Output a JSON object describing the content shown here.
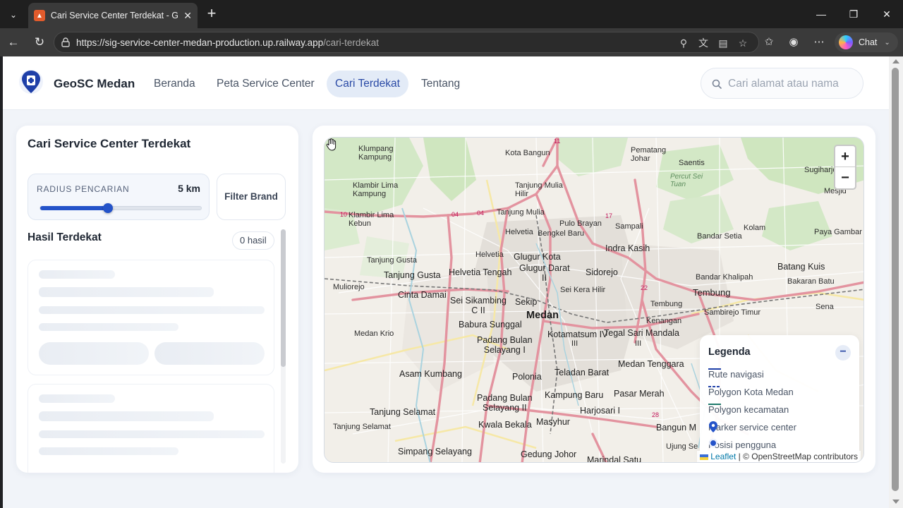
{
  "browser": {
    "tab_title": "Cari Service Center Terdekat - GeoSC Medan",
    "url_host": "https://sig-service-center-medan-production.up.railway.app",
    "url_path": "/cari-terdekat",
    "copilot_label": "Chat"
  },
  "navbar": {
    "brand": "GeoSC Medan",
    "links": [
      "Beranda",
      "Peta Service Center",
      "Cari Terdekat",
      "Tentang"
    ],
    "active_link": "Cari Terdekat",
    "search_placeholder": "Cari alamat atau nama"
  },
  "panel": {
    "title": "Cari Service Center Terdekat",
    "radius_label": "RADIUS PENCARIAN",
    "radius_value": "5 km",
    "radius_fraction": 0.42,
    "filter_button": "Filter Brand",
    "results_title": "Hasil Terdekat",
    "results_count": "0 hasil"
  },
  "map": {
    "zoom_in": "+",
    "zoom_out": "−",
    "legend_title": "Legenda",
    "legend_toggle": "−",
    "legend_items": [
      {
        "label": "Rute navigasi",
        "color": "#1e3fa8"
      },
      {
        "label": "Polygon Kota Medan",
        "color": "#1e3fa8"
      },
      {
        "label": "Polygon kecamatan",
        "color": "#1f7a6b"
      },
      {
        "label": "Marker service center",
        "color": "#2453c9"
      },
      {
        "label": "Posisi pengguna",
        "color": "#2453c9"
      }
    ],
    "attribution_leaflet": "Leaflet",
    "attribution_rest": " | © OpenStreetMap contributors",
    "place_labels": {
      "klumpang": "Klumpang\nKampung",
      "kota_bangun": "Kota Bangun",
      "pematang_johar": "Pematang\nJohar",
      "saentis": "Saentis",
      "klambir_lima_kampung": "Klambir Lima\nKampung",
      "tanjung_mulia_hilir": "Tanjung Mulia\nHilir",
      "percut_sei_tuan": "Percut Sei\nTuan",
      "sugiharjo": "Sugiharjo",
      "mesjid": "Mesjid",
      "klambir_lima_kebun": "Klambir Lima\nKebun",
      "tanjung_mulia": "Tanjung Mulia",
      "pulo_brayan": "Pulo Brayan",
      "sampali": "Sampali",
      "kolam": "Kolam",
      "paya_gambar": "Paya Gambar",
      "helvetia": "Helvetia",
      "bengkel_baru": "Bengkel Baru",
      "bandar_setia": "Bandar Setia",
      "helvetia2": "Helvetia",
      "glugur_kota": "Glugur Kota",
      "indra_kasih": "Indra Kasih",
      "tanjung_gusta": "Tanjung Gusta",
      "glugur_darat": "Glugur Darat",
      "sidorejo": "Sidorejo",
      "batang_kuis": "Batang Kuis",
      "tanjung_gusta2": "Tanjung Gusta",
      "helvetia_tengah": "Helvetia Tengah",
      "glugur_darat_ii": "II",
      "bandar_khalipah": "Bandar Khalipah",
      "bakaran_batu": "Bakaran Batu",
      "muliorejo": "Muliorejo",
      "cinta_damai": "Cinta Damai",
      "sei_kera_hilir": "Sei Kera Hilir",
      "tembung_big": "Tembung",
      "sei_sikambing": "Sei Sikambing\nC II",
      "sekip": "Sekip",
      "tembung": "Tembung",
      "sambirejo_timur": "Sambirejo Timur",
      "sena": "Sena",
      "babura_sunggal": "Babura Sunggal",
      "medan": "Medan",
      "kenangan": "Kenangan",
      "medan_krio": "Medan Krio",
      "kotamatsum_iv": "Kotamatsum IV",
      "tegal_sari_mandala": "Tegal Sari Mandala",
      "padang_bulan": "Padang Bulan\nSelayang I",
      "kotamatsum_iii": "III",
      "tegal_iii": "III",
      "medan_tenggara": "Medan Tenggara",
      "asam_kumbang": "Asam Kumbang",
      "polonia": "Polonia",
      "teladan_barat": "Teladan Barat",
      "kampung_baru": "Kampung Baru",
      "padang_bulan_ii": "Padang Bulan\nSelayang II",
      "pasar_merah": "Pasar Merah",
      "tanjung_selamat": "Tanjung Selamat",
      "harjosari_i": "Harjosari I",
      "kwala_bekala": "Kwala Bekala",
      "masyhur": "Masyhur",
      "bangun_m": "Bangun M",
      "tanjung_selamat2": "Tanjung Selamat",
      "simpang_selayang": "Simpang Selayang",
      "gedung_johor": "Gedung Johor",
      "ujung_se": "Ujung Se",
      "marindal_satu": "Marindal Satu"
    },
    "road_numbers": [
      "10",
      "04",
      "04",
      "11",
      "17",
      "22",
      "28"
    ]
  }
}
